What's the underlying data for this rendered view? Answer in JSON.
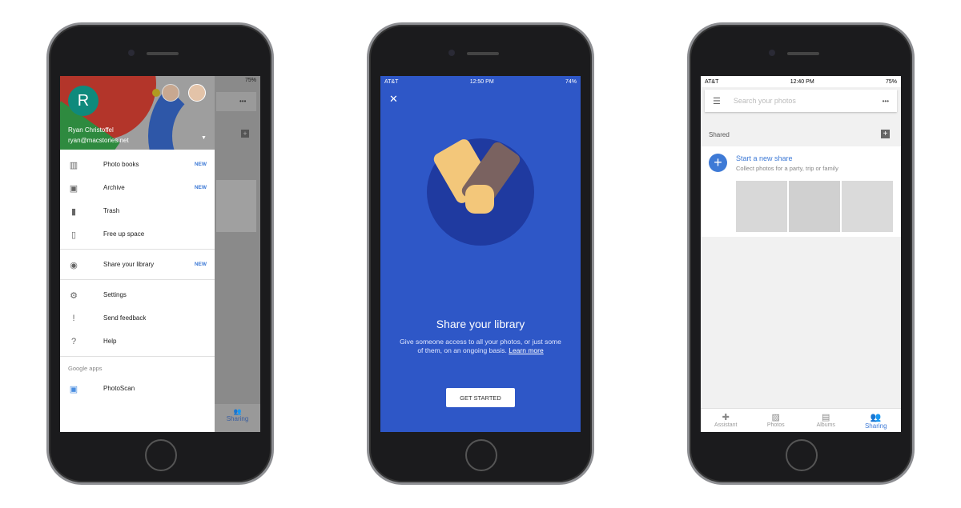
{
  "phone1": {
    "status": {
      "battery": "75%"
    },
    "drawer": {
      "name": "Ryan Christoffel",
      "email": "ryan@macstories.net",
      "avatar_letter": "R",
      "items": [
        {
          "label": "Photo books",
          "icon": "photo-book-icon",
          "badge": "NEW"
        },
        {
          "label": "Archive",
          "icon": "archive-icon",
          "badge": "NEW"
        },
        {
          "label": "Trash",
          "icon": "trash-icon",
          "badge": ""
        },
        {
          "label": "Free up space",
          "icon": "free-space-icon",
          "badge": ""
        },
        {
          "label": "Share your library",
          "icon": "share-library-icon",
          "badge": "NEW"
        },
        {
          "label": "Settings",
          "icon": "gear-icon",
          "badge": ""
        },
        {
          "label": "Send feedback",
          "icon": "feedback-icon",
          "badge": ""
        },
        {
          "label": "Help",
          "icon": "help-icon",
          "badge": ""
        }
      ],
      "section": "Google apps",
      "app": "PhotoScan"
    },
    "bg_tab": "Sharing"
  },
  "phone2": {
    "status": {
      "carrier": "AT&T",
      "time": "12:50 PM",
      "battery": "74%"
    },
    "title": "Share your library",
    "body": "Give someone access to all your photos, or just some of them, on an ongoing basis.",
    "link": "Learn more",
    "button": "GET STARTED",
    "bg_color": "#2e57c7"
  },
  "phone3": {
    "status": {
      "carrier": "AT&T",
      "time": "12:40 PM",
      "battery": "75%"
    },
    "search_placeholder": "Search your photos",
    "section": "Shared",
    "new_share_title": "Start a new share",
    "new_share_sub": "Collect photos for a party, trip or family",
    "tabs": [
      {
        "label": "Assistant"
      },
      {
        "label": "Photos"
      },
      {
        "label": "Albums"
      },
      {
        "label": "Sharing"
      }
    ],
    "accent": "#3e7ad6"
  }
}
